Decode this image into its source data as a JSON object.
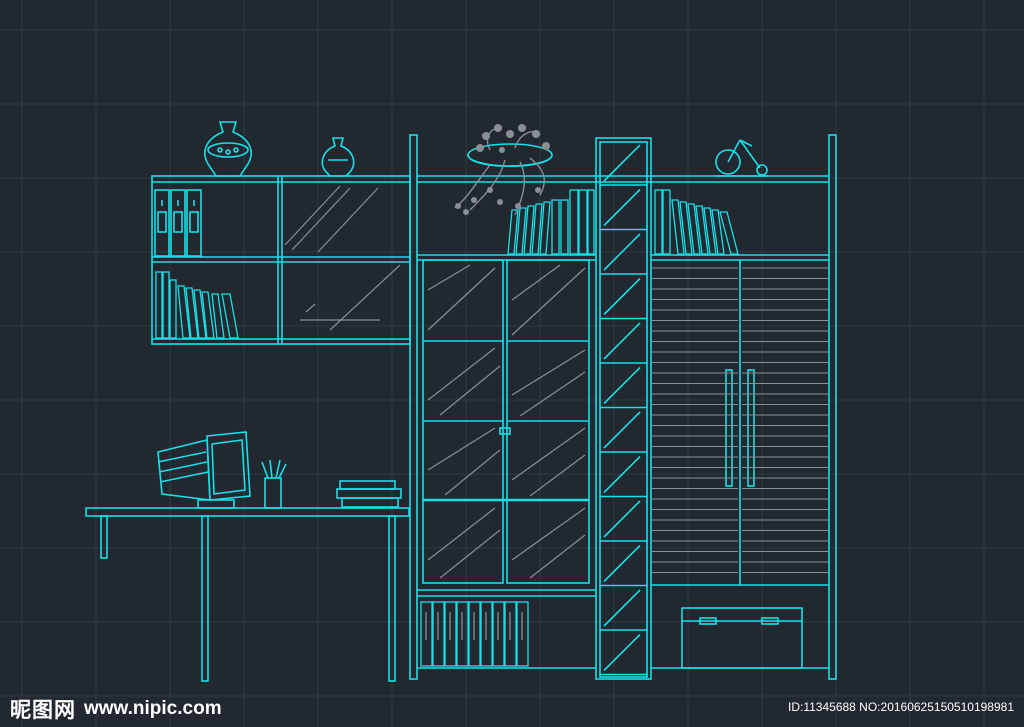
{
  "colors": {
    "background": "#212830",
    "grid": "#2f3844",
    "line": "#16e0e8",
    "gray": "#8a8f96",
    "watermark": "#ffffff"
  },
  "drawing": {
    "subject": "bookcase-and-desk-elevation",
    "items": [
      "wall-shelf",
      "glass-cabinet",
      "tall-shelf-column",
      "louvered-wardrobe",
      "desk",
      "crt-monitor",
      "pen-holder",
      "book-stack",
      "vase",
      "small-vase",
      "plant-pot",
      "bicycle-ornament",
      "binders",
      "storage-box"
    ]
  },
  "watermark": {
    "logo": "昵图网",
    "url": "www.nipic.com",
    "id_text": "ID:11345688 NO:20160625150510198981"
  }
}
